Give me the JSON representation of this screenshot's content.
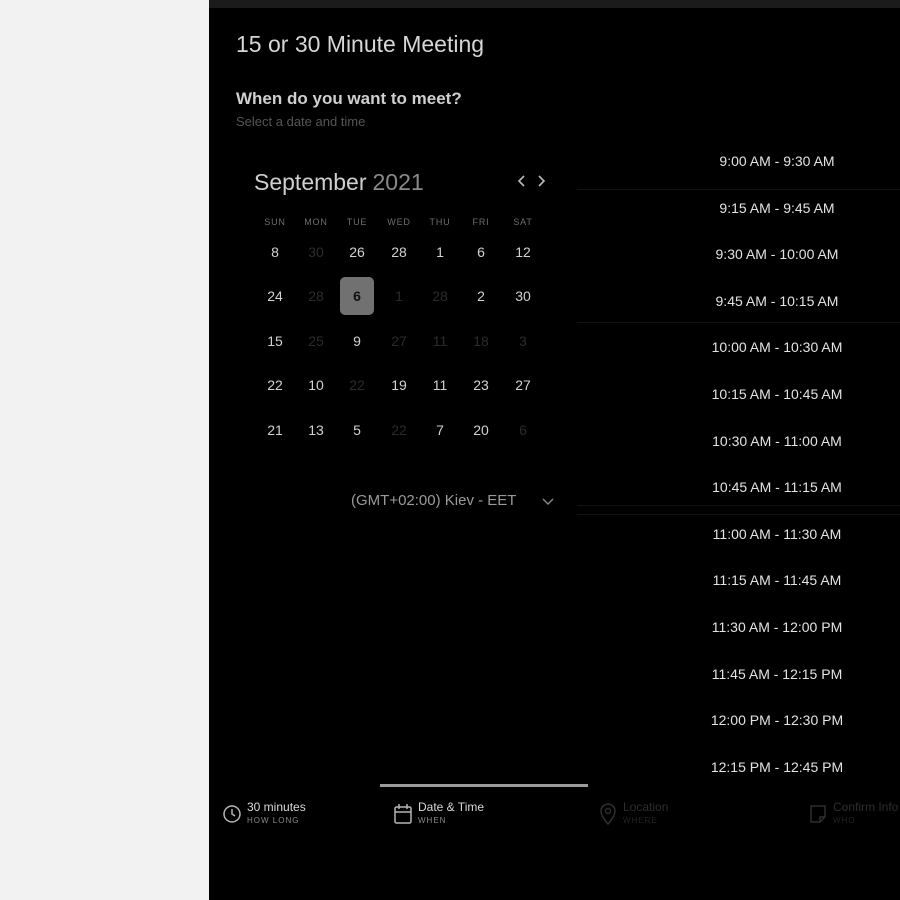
{
  "title": "15 or 30 Minute Meeting",
  "question": "When do you want to meet?",
  "subtitle": "Select a date and time",
  "calendar": {
    "month": "September",
    "year": "2021",
    "prev_icon": "chevron-left-icon",
    "next_icon": "chevron-right-icon",
    "weekdays": [
      "SUN",
      "MON",
      "TUE",
      "WED",
      "THU",
      "FRI",
      "SAT"
    ],
    "rows": [
      [
        {
          "d": "8"
        },
        {
          "d": "30",
          "muted": true
        },
        {
          "d": "26"
        },
        {
          "d": "28"
        },
        {
          "d": "1"
        },
        {
          "d": "6"
        },
        {
          "d": "12"
        }
      ],
      [
        {
          "d": "24"
        },
        {
          "d": "28",
          "muted": true
        },
        {
          "d": "6",
          "selected": true
        },
        {
          "d": "1",
          "muted": true
        },
        {
          "d": "28",
          "muted": true
        },
        {
          "d": "2"
        },
        {
          "d": "30"
        }
      ],
      [
        {
          "d": "15"
        },
        {
          "d": "25",
          "muted": true
        },
        {
          "d": "9"
        },
        {
          "d": "27",
          "muted": true
        },
        {
          "d": "11",
          "muted": true
        },
        {
          "d": "18",
          "muted": true
        },
        {
          "d": "3",
          "muted": true
        }
      ],
      [
        {
          "d": "22"
        },
        {
          "d": "10"
        },
        {
          "d": "22",
          "muted": true
        },
        {
          "d": "19"
        },
        {
          "d": "11"
        },
        {
          "d": "23"
        },
        {
          "d": "27"
        }
      ],
      [
        {
          "d": "21"
        },
        {
          "d": "13"
        },
        {
          "d": "5"
        },
        {
          "d": "22",
          "muted": true
        },
        {
          "d": "7"
        },
        {
          "d": "20"
        },
        {
          "d": "6",
          "muted": true
        }
      ]
    ]
  },
  "timezone": {
    "label": "(GMT+02:00) Kiev - EET",
    "icon": "chevron-down-icon"
  },
  "time_slots": [
    "9:00 AM - 9:30 AM",
    "9:15 AM - 9:45 AM",
    "9:30 AM - 10:00 AM",
    "9:45 AM - 10:15 AM",
    "10:00 AM - 10:30 AM",
    "10:15 AM - 10:45 AM",
    "10:30 AM - 11:00 AM",
    "10:45 AM - 11:15 AM",
    "11:00 AM - 11:30 AM",
    "11:15 AM - 11:45 AM",
    "11:30 AM - 12:00 PM",
    "11:45 AM - 12:15 PM",
    "12:00 PM - 12:30 PM",
    "12:15 PM - 12:45 PM"
  ],
  "steps": [
    {
      "label": "30 minutes",
      "sub": "HOW LONG",
      "icon": "clock-icon",
      "state": "active"
    },
    {
      "label": "Date & Time",
      "sub": "WHEN",
      "icon": "calendar-icon",
      "state": "active"
    },
    {
      "label": "Location",
      "sub": "WHERE",
      "icon": "map-pin-icon",
      "state": "dim"
    },
    {
      "label": "Confirm Info",
      "sub": "WHO",
      "icon": "note-icon",
      "state": "dim"
    }
  ],
  "colors": {
    "panel_bg": "#000000",
    "page_bg": "#f2f2f2",
    "selected_day_bg": "#717171",
    "progress": "#9a9a9a"
  }
}
